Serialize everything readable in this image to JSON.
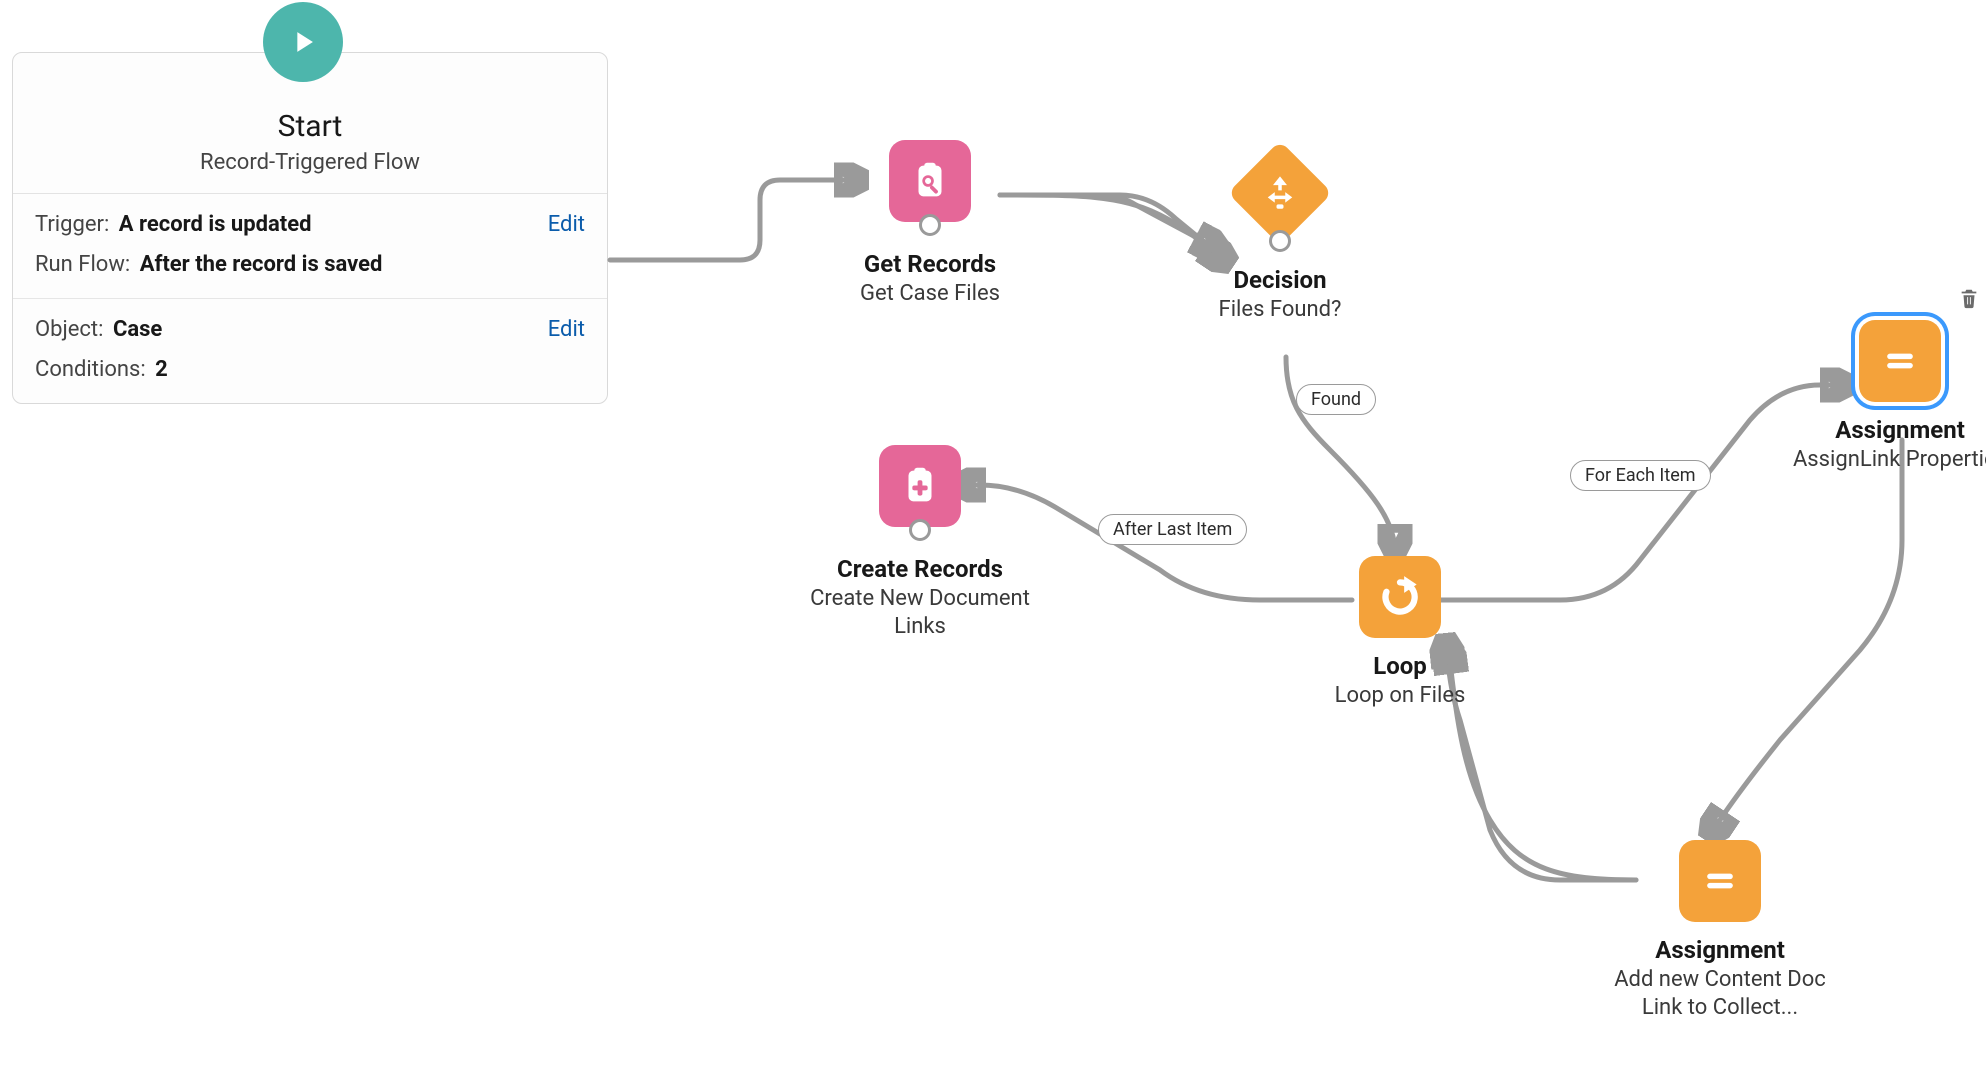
{
  "start": {
    "title": "Start",
    "subtitle": "Record-Triggered Flow",
    "trigger_label": "Trigger:",
    "trigger_value": "A record is updated",
    "run_label": "Run Flow:",
    "run_value": "After the record is saved",
    "object_label": "Object:",
    "object_value": "Case",
    "conditions_label": "Conditions:",
    "conditions_value": "2",
    "edit_label": "Edit"
  },
  "nodes": {
    "get_records": {
      "title": "Get Records",
      "subtitle": "Get Case Files"
    },
    "decision": {
      "title": "Decision",
      "subtitle": "Files Found?"
    },
    "loop": {
      "title": "Loop",
      "subtitle": "Loop on Files"
    },
    "assignment_top": {
      "title": "Assignment",
      "subtitle": "AssignLink Properties"
    },
    "assignment_bottom": {
      "title": "Assignment",
      "subtitle": "Add new Content Doc Link to Collect..."
    },
    "create_records": {
      "title": "Create Records",
      "subtitle": "Create New Document Links"
    }
  },
  "edges": {
    "found": "Found",
    "for_each": "For Each Item",
    "after_last": "After Last Item"
  },
  "colors": {
    "pink": "#e56798",
    "orange": "#f4a23a",
    "teal": "#4db6ac",
    "connector": "#9a9a9a",
    "link": "#0b5cab",
    "selection": "#3b99fc"
  }
}
